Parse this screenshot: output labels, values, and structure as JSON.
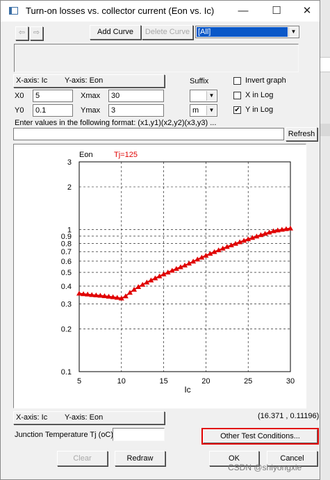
{
  "window": {
    "title": "Turn-on losses vs. collector current (Eon vs. Ic)",
    "controls": {
      "minimize": "—",
      "maximize": "☐",
      "close": "✕"
    }
  },
  "toolbar": {
    "back_icon": "arrow-left-icon",
    "forward_icon": "arrow-right-icon",
    "add_curve_label": "Add Curve",
    "delete_curve_label": "Delete Curve",
    "curve_select_value": "[All]"
  },
  "axes_header": {
    "x_axis": "X-axis: Ic",
    "y_axis": "Y-axis: Eon"
  },
  "fields": {
    "x0_label": "X0",
    "x0_value": "5",
    "xmax_label": "Xmax",
    "xmax_value": "30",
    "y0_label": "Y0",
    "y0_value": "0.1",
    "ymax_label": "Ymax",
    "ymax_value": "3"
  },
  "suffix": {
    "label": "Suffix",
    "x_value": "",
    "y_value": "m"
  },
  "options": {
    "invert_label": "Invert graph",
    "invert_checked": false,
    "xlog_label": "X in Log",
    "xlog_checked": false,
    "ylog_label": "Y in Log",
    "ylog_checked": true
  },
  "format_hint": "Enter values in the following format:  (x1,y1)(x2,y2)(x3,y3) ...",
  "refresh_label": "Refresh",
  "chart_data": {
    "type": "line",
    "ylabel": "Eon",
    "xlabel": "Ic",
    "series_label": "Tj=125",
    "x_scale": "linear",
    "y_scale": "log",
    "xlim": [
      5,
      30
    ],
    "ylim": [
      0.1,
      3
    ],
    "x_ticks": [
      5,
      10,
      15,
      20,
      25,
      30
    ],
    "y_ticks": [
      0.1,
      0.2,
      0.3,
      0.4,
      0.5,
      0.6,
      0.7,
      0.8,
      0.9,
      1,
      2,
      3
    ],
    "y_tick_labels": [
      "0.1",
      "0.2",
      "0.3",
      "0.4",
      "0.5",
      "0.6",
      "0.7",
      "0.8",
      "0.9",
      "1",
      "2",
      "3"
    ],
    "grid": true,
    "series": [
      {
        "name": "Tj=125",
        "color": "#e00000",
        "marker": "triangle",
        "x": [
          5.0,
          5.5,
          6.0,
          6.5,
          7.0,
          7.5,
          8.0,
          8.5,
          9.0,
          9.5,
          10.0,
          10.5,
          11.0,
          11.5,
          12.0,
          12.5,
          13.0,
          13.5,
          14.0,
          14.5,
          15.0,
          15.5,
          16.0,
          16.5,
          17.0,
          17.5,
          18.0,
          18.5,
          19.0,
          19.5,
          20.0,
          20.5,
          21.0,
          21.5,
          22.0,
          22.5,
          23.0,
          23.5,
          24.0,
          24.5,
          25.0,
          25.5,
          26.0,
          26.5,
          27.0,
          27.5,
          28.0,
          28.5,
          29.0,
          29.5,
          30.0
        ],
        "y": [
          0.355,
          0.352,
          0.35,
          0.347,
          0.345,
          0.343,
          0.341,
          0.338,
          0.335,
          0.332,
          0.328,
          0.34,
          0.36,
          0.378,
          0.395,
          0.41,
          0.425,
          0.44,
          0.455,
          0.47,
          0.485,
          0.5,
          0.515,
          0.53,
          0.545,
          0.56,
          0.578,
          0.597,
          0.617,
          0.637,
          0.657,
          0.677,
          0.697,
          0.717,
          0.737,
          0.757,
          0.777,
          0.797,
          0.817,
          0.837,
          0.857,
          0.877,
          0.897,
          0.917,
          0.937,
          0.957,
          0.977,
          0.99,
          1.0,
          1.01,
          1.02
        ]
      }
    ]
  },
  "footer": {
    "x_axis": "X-axis: Ic",
    "y_axis": "Y-axis: Eon",
    "coords": "(16.371 , 0.11196)",
    "junction_label": "Junction Temperature Tj (oC)",
    "junction_value": "",
    "other_conditions_label": "Other Test Conditions...",
    "other_conditions_highlight": "#e00000",
    "clear_label": "Clear",
    "redraw_label": "Redraw",
    "ok_label": "OK",
    "cancel_label": "Cancel"
  },
  "watermark": "CSDN @shiyongxie"
}
